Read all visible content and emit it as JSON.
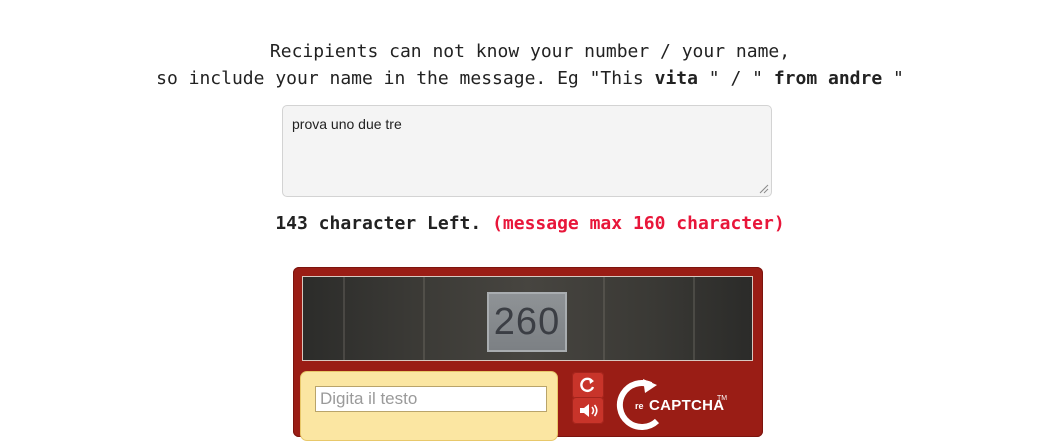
{
  "instructions": {
    "line1": "Recipients can not know your number / your name,",
    "line2_pre": "so include your name in the message. Eg \"This ",
    "line2_name1": "vita",
    "line2_mid": " \" / \" ",
    "line2_name2": "from andre",
    "line2_post": " \""
  },
  "message": {
    "value": "prova uno due tre"
  },
  "counter": {
    "left_text": "143 character Left.",
    "limit_text": "(message max 160 character)"
  },
  "captcha": {
    "image_text": "260",
    "input_placeholder": "Digita il testo",
    "refresh_icon": "refresh-icon",
    "audio_icon": "audio-icon",
    "logo_re": "re",
    "logo_word": "CAPTCHA",
    "logo_tm": "TM",
    "colors": {
      "frame": "#9a1d15",
      "panel": "#fbe6a2",
      "button": "#c8342a"
    }
  }
}
